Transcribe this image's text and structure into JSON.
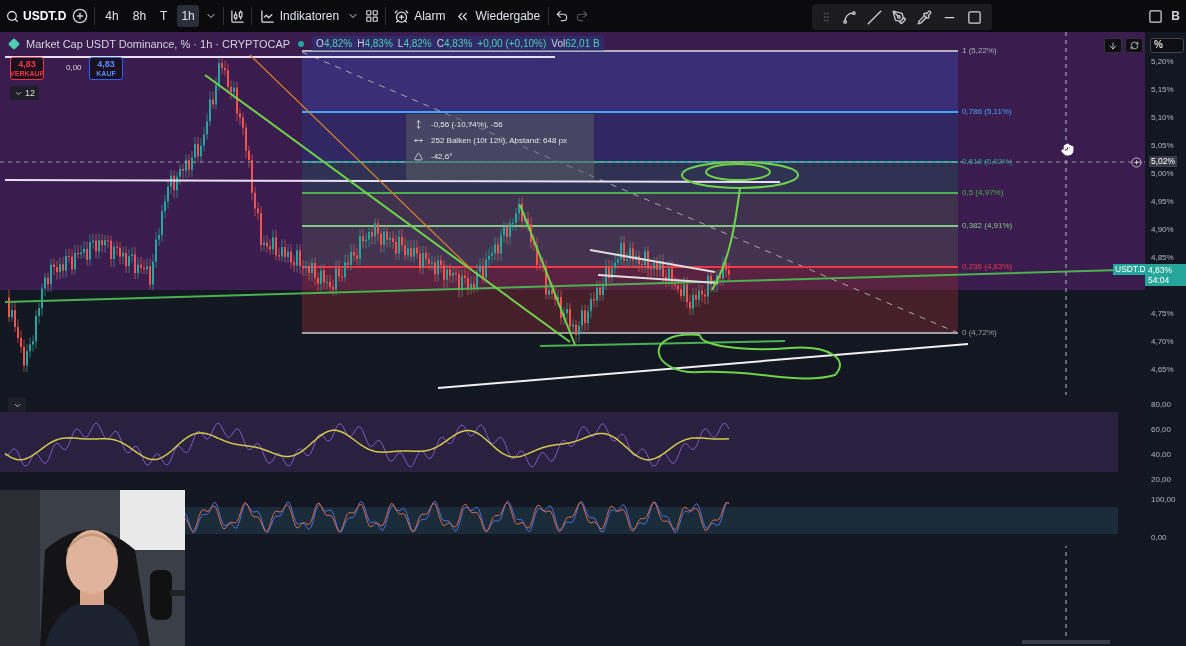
{
  "toolbar": {
    "symbol": "USDT.D",
    "intervals": [
      {
        "label": "4h",
        "selected": false
      },
      {
        "label": "8h",
        "selected": false
      },
      {
        "label": "T",
        "selected": false
      },
      {
        "label": "1h",
        "selected": true
      }
    ],
    "indicators": "Indikatoren",
    "alarm": "Alarm",
    "replay": "Wiedergabe",
    "cut_label": "B"
  },
  "legend": {
    "title": "Market Cap USDT Dominance, % · 1h · CRYPTOCAP",
    "ohlc": [
      {
        "key": "O",
        "value": "4,82%"
      },
      {
        "key": "H",
        "value": "4,83%"
      },
      {
        "key": "L",
        "value": "4,82%"
      },
      {
        "key": "C",
        "value": "4,83%"
      }
    ],
    "change": "+0,00 (+0,10%)",
    "volume_key": "Vol",
    "volume": "62,01 B"
  },
  "trade": {
    "sell_price": "4,83",
    "sell_label": "VERKAUF",
    "spread": "0,00",
    "buy_price": "4,83",
    "buy_label": "KAUF"
  },
  "collapse_count": "12",
  "measure": [
    "-0,56 (-10,74%), -56",
    "252 Balken (10t 12h), Abstand: 648 px",
    "-42,6°"
  ],
  "fib_levels": [
    {
      "label": "1 (5,22%)",
      "color": "#b0b0b8"
    },
    {
      "label": "0,786 (5,11%)",
      "color": "#42a5f5"
    },
    {
      "label": "0,618 (5,02%)",
      "color": "#26a69a"
    },
    {
      "label": "0,5 (4,97%)",
      "color": "#4caf50"
    },
    {
      "label": "0,382 (4,91%)",
      "color": "#81c784"
    },
    {
      "label": "0,236 (4,83%)",
      "color": "#f23645"
    },
    {
      "label": "0 (4,72%)",
      "color": "#9e9e9e"
    }
  ],
  "price_axis": {
    "unit": "%",
    "ticks": [
      "5,20%",
      "5,15%",
      "5,10%",
      "5,05%",
      "5,00%",
      "4,95%",
      "4,90%",
      "4,85%",
      "4,75%",
      "4,70%",
      "4,65%"
    ],
    "crosshair": "5,02%",
    "symbol_tag": "USDT.D",
    "last_price": "4,83%",
    "countdown": "54:04"
  },
  "rsi_axis": [
    "80,00",
    "60,00",
    "40,00",
    "20,00"
  ],
  "stoch_axis": [
    "100,00",
    "0,00"
  ],
  "webcam": {
    "kind": "picture"
  }
}
